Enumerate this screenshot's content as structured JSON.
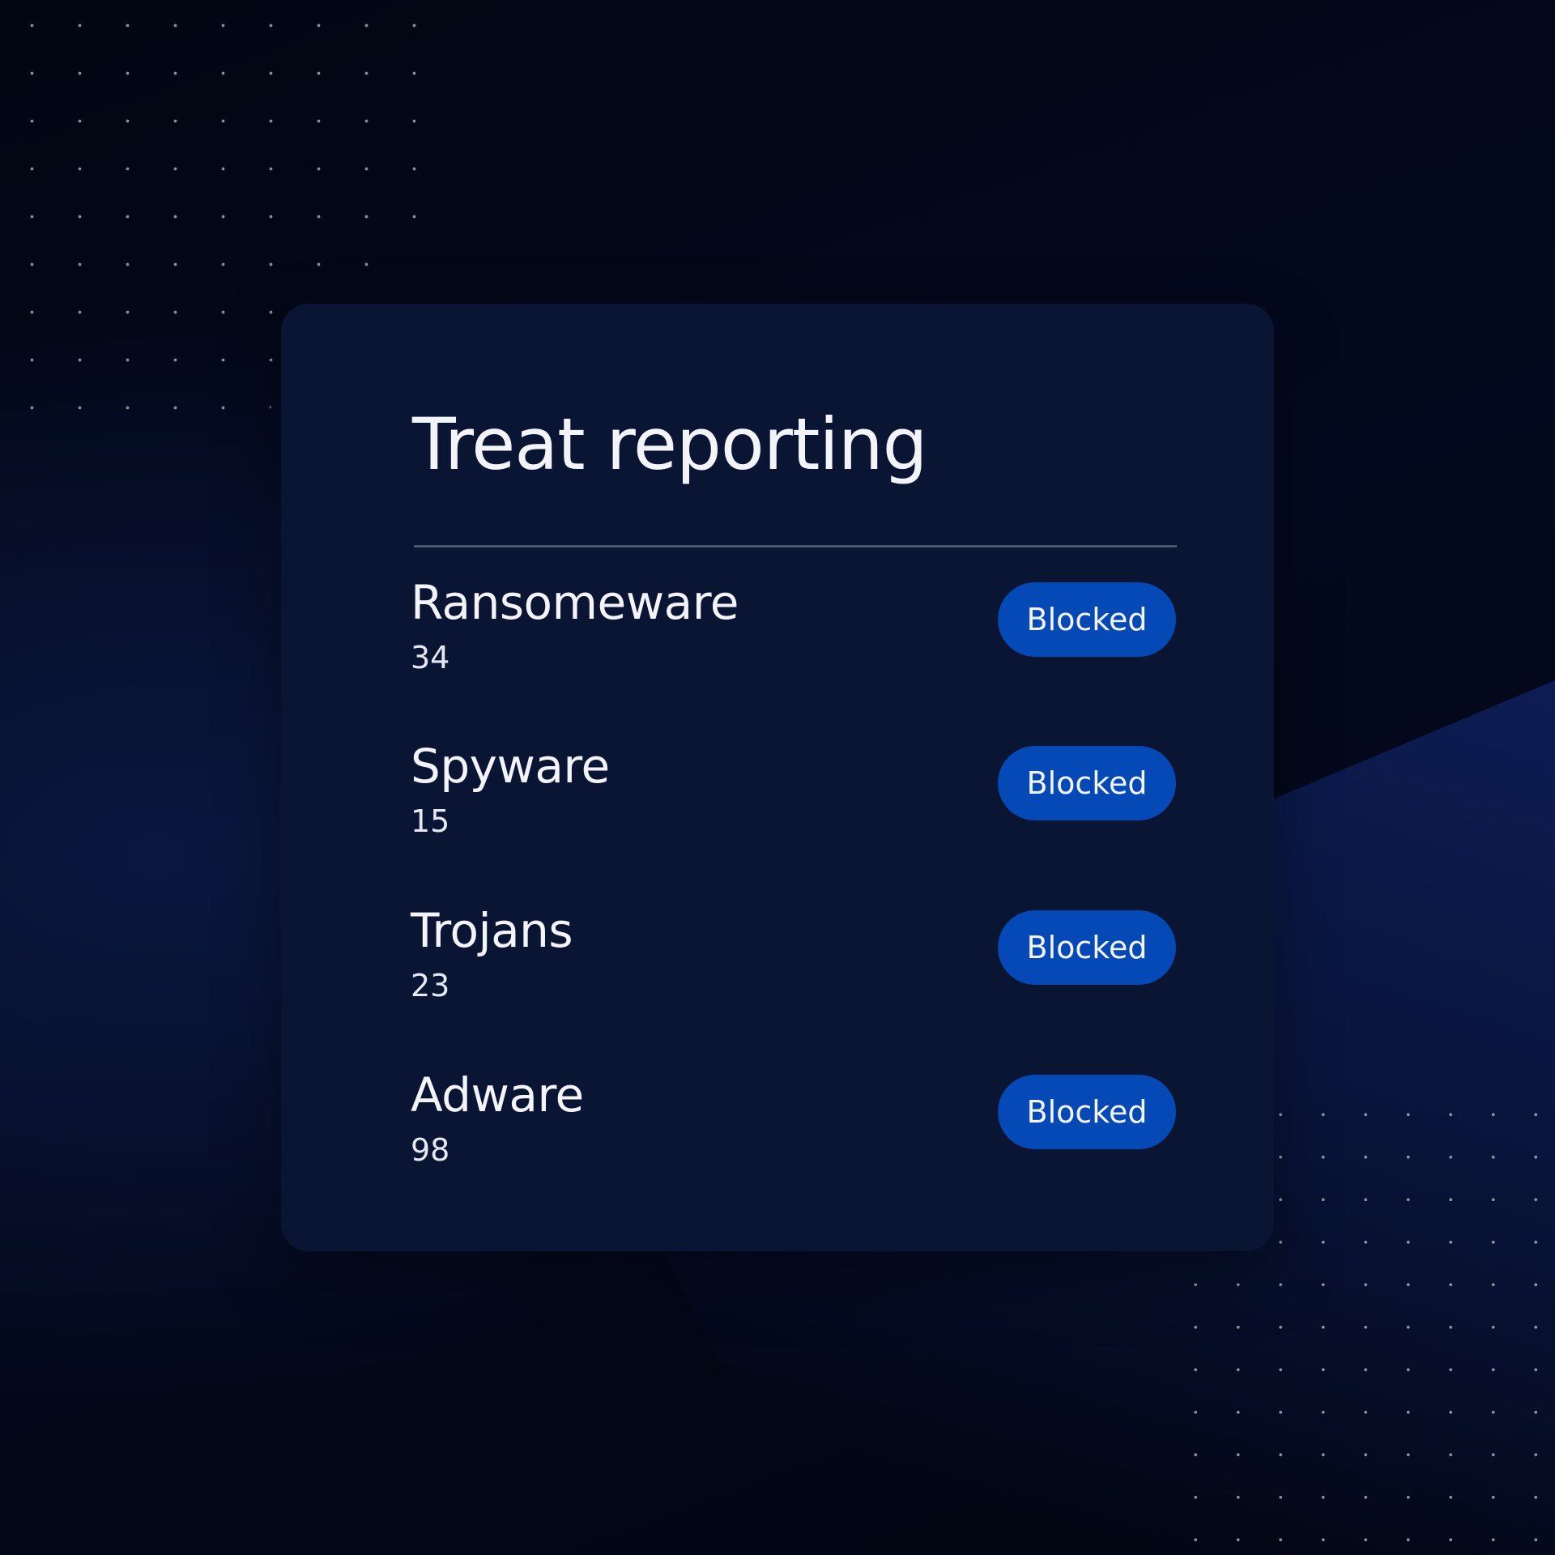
{
  "card": {
    "title": "Treat reporting"
  },
  "threats": [
    {
      "name": "Ransomeware",
      "count": "34",
      "status": "Blocked"
    },
    {
      "name": "Spyware",
      "count": "15",
      "status": "Blocked"
    },
    {
      "name": "Trojans",
      "count": "23",
      "status": "Blocked"
    },
    {
      "name": "Adware",
      "count": "98",
      "status": "Blocked"
    }
  ],
  "colors": {
    "background": "#030a1f",
    "card": "#0a1433",
    "badge": "#0449b5",
    "text": "#f2f4fa",
    "divider": "#4b5670"
  }
}
